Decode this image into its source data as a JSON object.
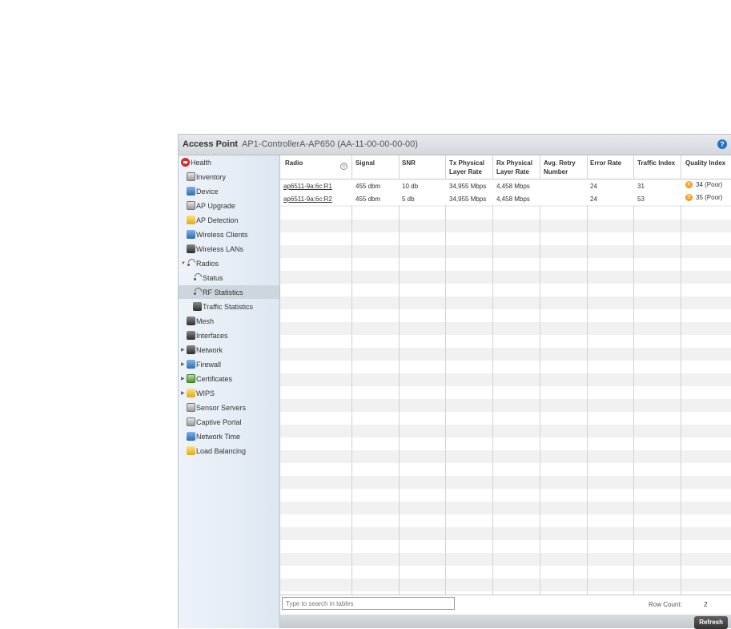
{
  "header": {
    "title": "Access Point",
    "subtitle": "AP1-ControllerA-AP650 (AA-11-00-00-00-00)",
    "help": "?"
  },
  "sidebar": {
    "items": [
      {
        "label": "Health",
        "icon": "health-icon"
      },
      {
        "label": "Inventory",
        "icon": "inventory-icon"
      },
      {
        "label": "Device",
        "icon": "device-icon"
      },
      {
        "label": "AP Upgrade",
        "icon": "ap-upgrade-icon"
      },
      {
        "label": "AP Detection",
        "icon": "ap-detection-icon"
      },
      {
        "label": "Wireless Clients",
        "icon": "wireless-clients-icon"
      },
      {
        "label": "Wireless LANs",
        "icon": "wireless-lans-icon"
      },
      {
        "label": "Radios",
        "icon": "radio-icon"
      },
      {
        "label": "Status",
        "icon": "radio-icon"
      },
      {
        "label": "RF Statistics",
        "icon": "radio-icon",
        "selected": true
      },
      {
        "label": "Traffic Statistics",
        "icon": "traffic-icon"
      },
      {
        "label": "Mesh",
        "icon": "mesh-icon"
      },
      {
        "label": "Interfaces",
        "icon": "interfaces-icon"
      },
      {
        "label": "Network",
        "icon": "network-icon"
      },
      {
        "label": "Firewall",
        "icon": "firewall-icon"
      },
      {
        "label": "Certificates",
        "icon": "certificates-icon"
      },
      {
        "label": "WIPS",
        "icon": "wips-icon"
      },
      {
        "label": "Sensor Servers",
        "icon": "sensor-servers-icon"
      },
      {
        "label": "Captive Portal",
        "icon": "captive-portal-icon"
      },
      {
        "label": "Network Time",
        "icon": "network-time-icon"
      },
      {
        "label": "Load Balancing",
        "icon": "load-balancing-icon"
      }
    ]
  },
  "table": {
    "columns": [
      {
        "line1": "Radio",
        "line2": ""
      },
      {
        "line1": "Signal",
        "line2": ""
      },
      {
        "line1": "SNR",
        "line2": ""
      },
      {
        "line1": "Tx Physical",
        "line2": "Layer Rate"
      },
      {
        "line1": "Rx Physical",
        "line2": "Layer Rate"
      },
      {
        "line1": "Avg. Retry",
        "line2": "Number"
      },
      {
        "line1": "Error Rate",
        "line2": ""
      },
      {
        "line1": "Traffic Index",
        "line2": ""
      },
      {
        "line1": "Quality Index",
        "line2": ""
      }
    ],
    "rows": [
      [
        "ap6511-9a:6c:R1",
        "455 dbm",
        "10 db",
        "34,955 Mbps",
        "4,458 Mbps",
        "",
        "24",
        "31",
        "34 (Poor)"
      ],
      [
        "ap6511-9a:6c:R2",
        "455 dbm",
        "5 db",
        "34,955 Mbps",
        "4,458 Mbps",
        "",
        "24",
        "53",
        "35 (Poor)"
      ]
    ],
    "quality_icon": "!!",
    "quality_color": "#f39a1e"
  },
  "footer": {
    "search_placeholder": "Type to search in tables",
    "row_count_label": "Row Count:",
    "row_count": "2"
  },
  "actions": {
    "refresh_label": "Refresh"
  }
}
